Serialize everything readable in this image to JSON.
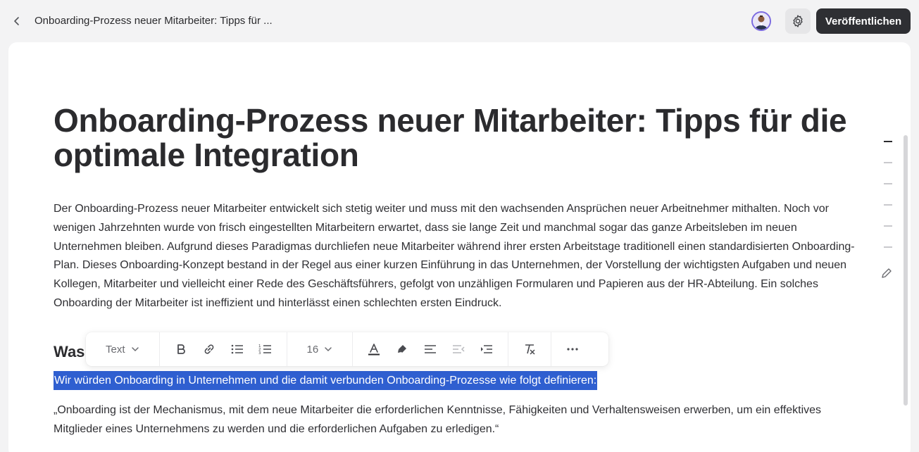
{
  "header": {
    "back_icon": "chevron-left-icon",
    "doc_title": "Onboarding-Prozess neuer Mitarbeiter: Tipps für ...",
    "settings_icon": "gear-icon",
    "publish_label": "Veröffentlichen"
  },
  "article": {
    "title": "Onboarding-Prozess neuer Mitarbeiter: Tipps für die optimale Integration",
    "intro": "Der Onboarding-Prozess neuer Mitarbeiter entwickelt sich stetig weiter und muss mit den wachsenden Ansprüchen neuer Arbeitnehmer mithalten. Noch vor wenigen Jahrzehnten wurde von frisch eingestellten Mitarbeitern erwartet, dass sie lange Zeit und manchmal sogar das ganze Arbeitsleben im neuen Unternehmen bleiben. Aufgrund dieses Paradigmas durchliefen neue Mitarbeiter während ihrer ersten Arbeitstage traditionell einen standardisierten Onboarding-Plan. Dieses Onboarding-Konzept bestand in der Regel aus einer kurzen Einführung in das Unternehmen, der Vorstellung der wichtigsten Aufgaben und neuen Kollegen, Mitarbeiter und vielleicht einer Rede des Geschäftsführers, gefolgt von unzähligen Formularen und Papieren aus der HR-Abteilung. Ein solches Onboarding der Mitarbeiter ist ineffizient und hinterlässt einen schlechten ersten Eindruck.",
    "section_heading": "Was",
    "selected_text": "Wir würden Onboarding in Unternehmen und die damit verbunden Onboarding-Prozesse wie folgt definieren:",
    "quote": "„Onboarding ist der Mechanismus, mit dem neue Mitarbeiter die erforderlichen Kenntnisse, Fähigkeiten und Verhaltensweisen erwerben, um ein effektives Mitglieder eines Unternehmens zu werden und die erforderlichen Aufgaben zu erledigen.“"
  },
  "toolbar": {
    "block_type": "Text",
    "font_size": "16",
    "icons": [
      "bold-icon",
      "link-icon",
      "bullet-list-icon",
      "numbered-list-icon",
      "text-color-icon",
      "highlighter-icon",
      "align-left-icon",
      "outdent-icon",
      "indent-icon",
      "clear-format-icon",
      "more-icon"
    ]
  },
  "colors": {
    "selection": "#2f5fd0",
    "publish_button": "#2e2f33",
    "avatar_ring": "#7b6ae0"
  }
}
